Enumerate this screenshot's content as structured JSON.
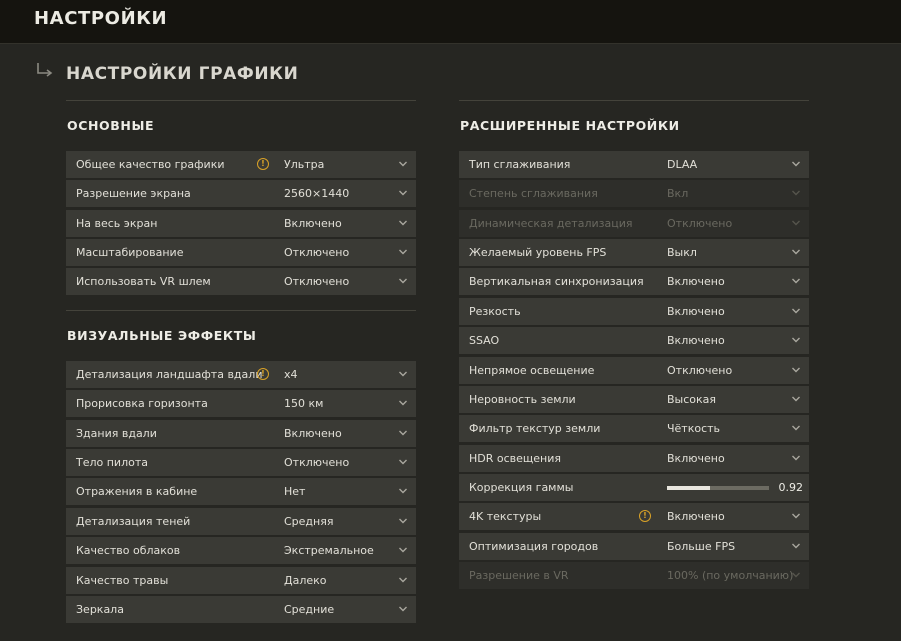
{
  "header": {
    "title": "НАСТРОЙКИ"
  },
  "page": {
    "title": "НАСТРОЙКИ ГРАФИКИ"
  },
  "colors": {
    "background": "#262622",
    "row": "#3a3a35",
    "warning": "#d9a227",
    "topbar": "#15140f"
  },
  "basic": {
    "title": "ОСНОВНЫЕ",
    "rows": [
      {
        "label": "Общее качество графики",
        "value": "Ультра",
        "warning": true
      },
      {
        "label": "Разрешение экрана",
        "value": "2560×1440"
      },
      {
        "label": "На весь экран",
        "value": "Включено"
      },
      {
        "label": "Масштабирование",
        "value": "Отключено"
      },
      {
        "label": "Использовать VR шлем",
        "value": "Отключено"
      }
    ]
  },
  "visual": {
    "title": "ВИЗУАЛЬНЫЕ ЭФФЕКТЫ",
    "rows": [
      {
        "label": "Детализация ландшафта вдали",
        "value": "x4",
        "warning": true
      },
      {
        "label": "Прорисовка горизонта",
        "value": "150 км"
      },
      {
        "label": "Здания вдали",
        "value": "Включено"
      },
      {
        "label": "Тело пилота",
        "value": "Отключено"
      },
      {
        "label": "Отражения в кабине",
        "value": "Нет"
      },
      {
        "label": "Детализация теней",
        "value": "Средняя"
      },
      {
        "label": "Качество облаков",
        "value": "Экстремальное"
      },
      {
        "label": "Качество травы",
        "value": "Далеко"
      },
      {
        "label": "Зеркала",
        "value": "Средние"
      }
    ]
  },
  "advanced": {
    "title": "РАСШИРЕННЫЕ НАСТРОЙКИ",
    "rows": [
      {
        "label": "Тип сглаживания",
        "value": "DLAA"
      },
      {
        "label": "Степень сглаживания",
        "value": "Вкл",
        "disabled": true
      },
      {
        "label": "Динамическая детализация",
        "value": "Отключено",
        "disabled": true
      },
      {
        "label": "Желаемый уровень FPS",
        "value": "Выкл"
      },
      {
        "label": "Вертикальная синхронизация",
        "value": "Включено"
      },
      {
        "label": "Резкость",
        "value": "Включено"
      },
      {
        "label": "SSAO",
        "value": "Включено"
      },
      {
        "label": "Непрямое освещение",
        "value": "Отключено"
      },
      {
        "label": "Неровность земли",
        "value": "Высокая"
      },
      {
        "label": "Фильтр текстур земли",
        "value": "Чёткость"
      },
      {
        "label": "HDR освещения",
        "value": "Включено"
      },
      {
        "label": "Коррекция гаммы",
        "type": "slider",
        "value": "0.92",
        "fill": 0.42
      },
      {
        "label": "4K текстуры",
        "value": "Включено",
        "warning": true
      },
      {
        "label": "Оптимизация городов",
        "value": "Больше FPS"
      },
      {
        "label": "Разрешение в VR",
        "value": "100% (по умолчанию)",
        "disabled": true
      }
    ]
  }
}
